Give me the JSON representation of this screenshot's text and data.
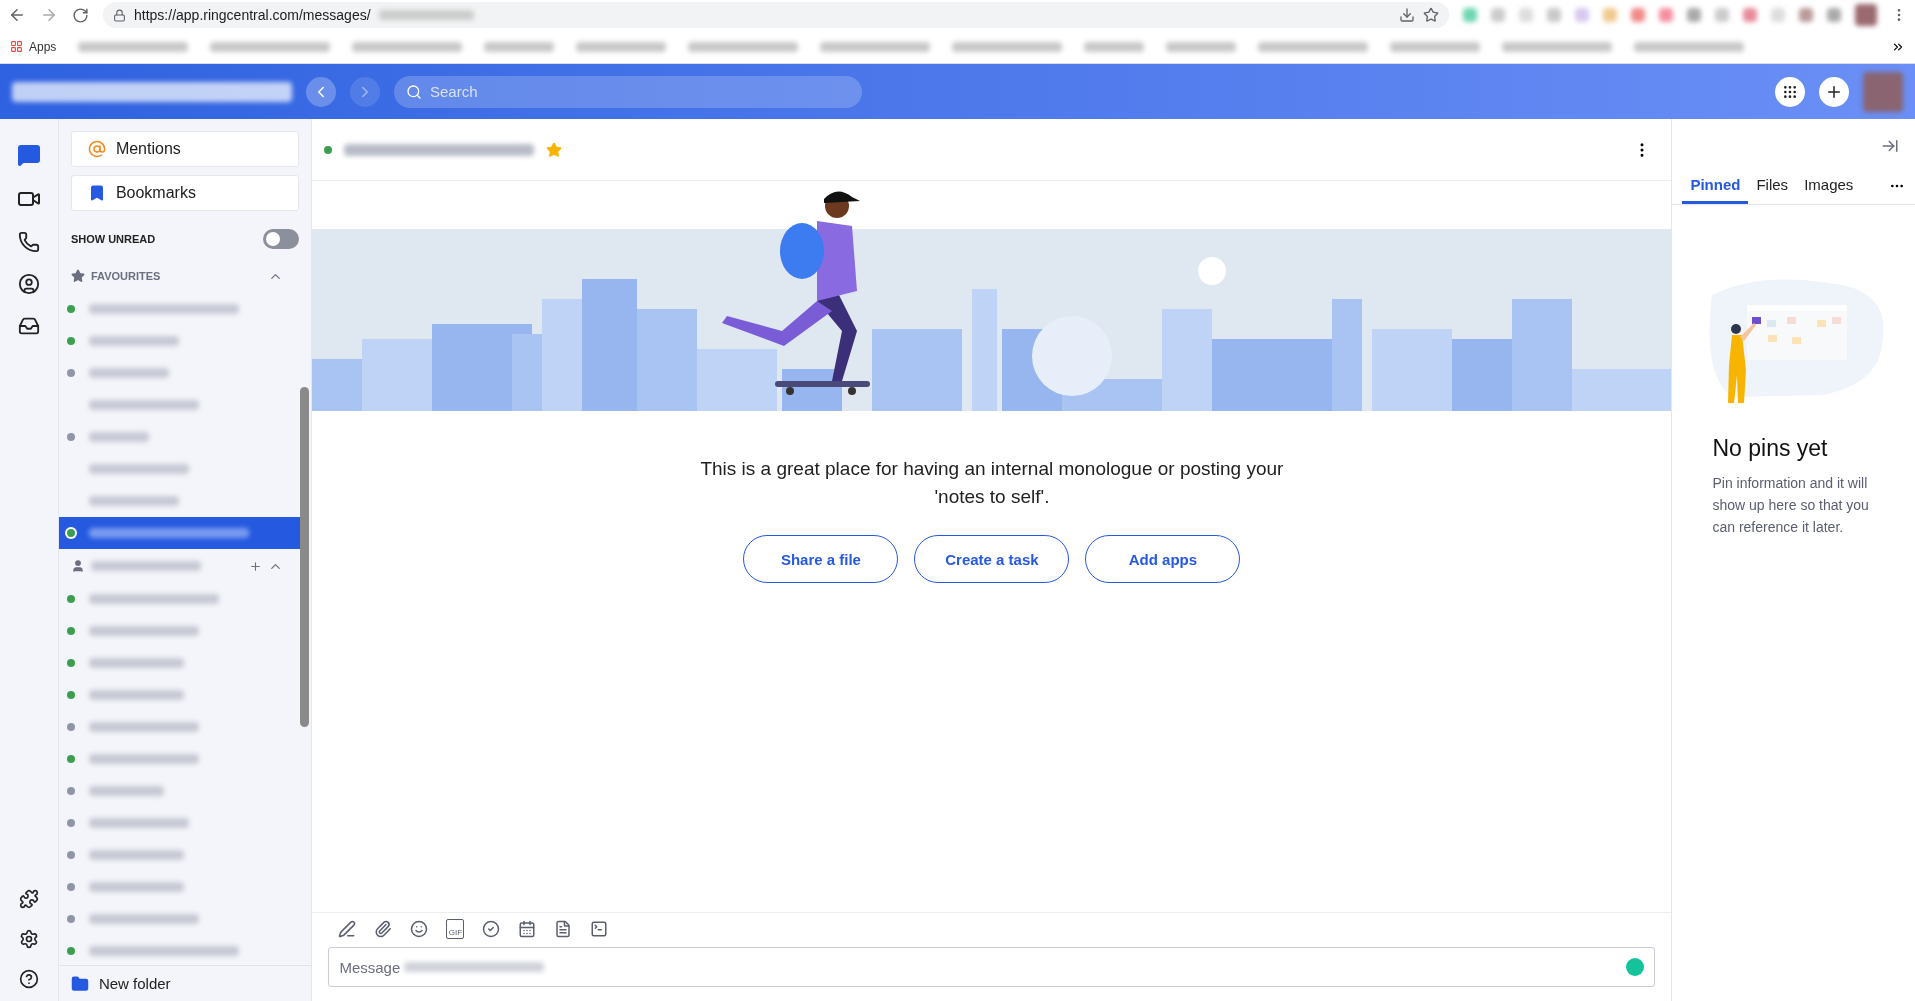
{
  "browser": {
    "url": "https://app.ringcentral.com/messages/",
    "apps_label": "Apps"
  },
  "header": {
    "search": {
      "placeholder": "Search"
    }
  },
  "sidebar": {
    "quick_links": [
      {
        "kind": "mentions",
        "label": "Mentions"
      },
      {
        "kind": "bookmarks",
        "label": "Bookmarks"
      }
    ],
    "show_unread": {
      "label": "SHOW UNREAD",
      "on": false
    },
    "favourites": {
      "title": "FAVOURITES",
      "expanded": true,
      "items": [
        {
          "color": "#3aa050",
          "selected": false
        },
        {
          "color": "#3aa050",
          "selected": false
        },
        {
          "color": "#9095a8",
          "selected": false
        },
        {
          "selected": false
        },
        {
          "color": "#9095a8",
          "selected": false
        },
        {
          "selected": false
        },
        {
          "selected": false
        },
        {
          "color": "#3aa050",
          "selected": true
        }
      ]
    },
    "direct": {
      "expanded": true,
      "items": [
        {
          "color": "#3aa050",
          "selected": false
        },
        {
          "color": "#3aa050",
          "selected": false
        },
        {
          "color": "#3aa050",
          "selected": false
        },
        {
          "color": "#3aa050",
          "selected": false
        },
        {
          "color": "#9095a8",
          "selected": false
        },
        {
          "color": "#3aa050",
          "selected": false
        },
        {
          "color": "#9095a8",
          "selected": false
        },
        {
          "color": "#9095a8",
          "selected": false
        },
        {
          "color": "#9095a8",
          "selected": false
        },
        {
          "color": "#9095a8",
          "selected": false
        },
        {
          "color": "#9095a8",
          "selected": false
        },
        {
          "color": "#3aa050",
          "selected": false
        }
      ]
    },
    "new_folder": "New folder"
  },
  "conversation": {
    "online": true,
    "favourite": true,
    "intro": "This is a great place for having an internal monologue or posting your 'notes to self'.",
    "actions": [
      "Share a file",
      "Create a task",
      "Add apps"
    ],
    "composer": {
      "gif_label": "GIF",
      "placeholder_prefix": "Message "
    }
  },
  "right_panel": {
    "tabs": [
      {
        "label": "Pinned",
        "selected": true
      },
      {
        "label": "Files",
        "selected": false
      },
      {
        "label": "Images",
        "selected": false
      }
    ],
    "empty_title": "No pins yet",
    "empty_text": "Pin information and it will show up here so that you can reference it later."
  }
}
